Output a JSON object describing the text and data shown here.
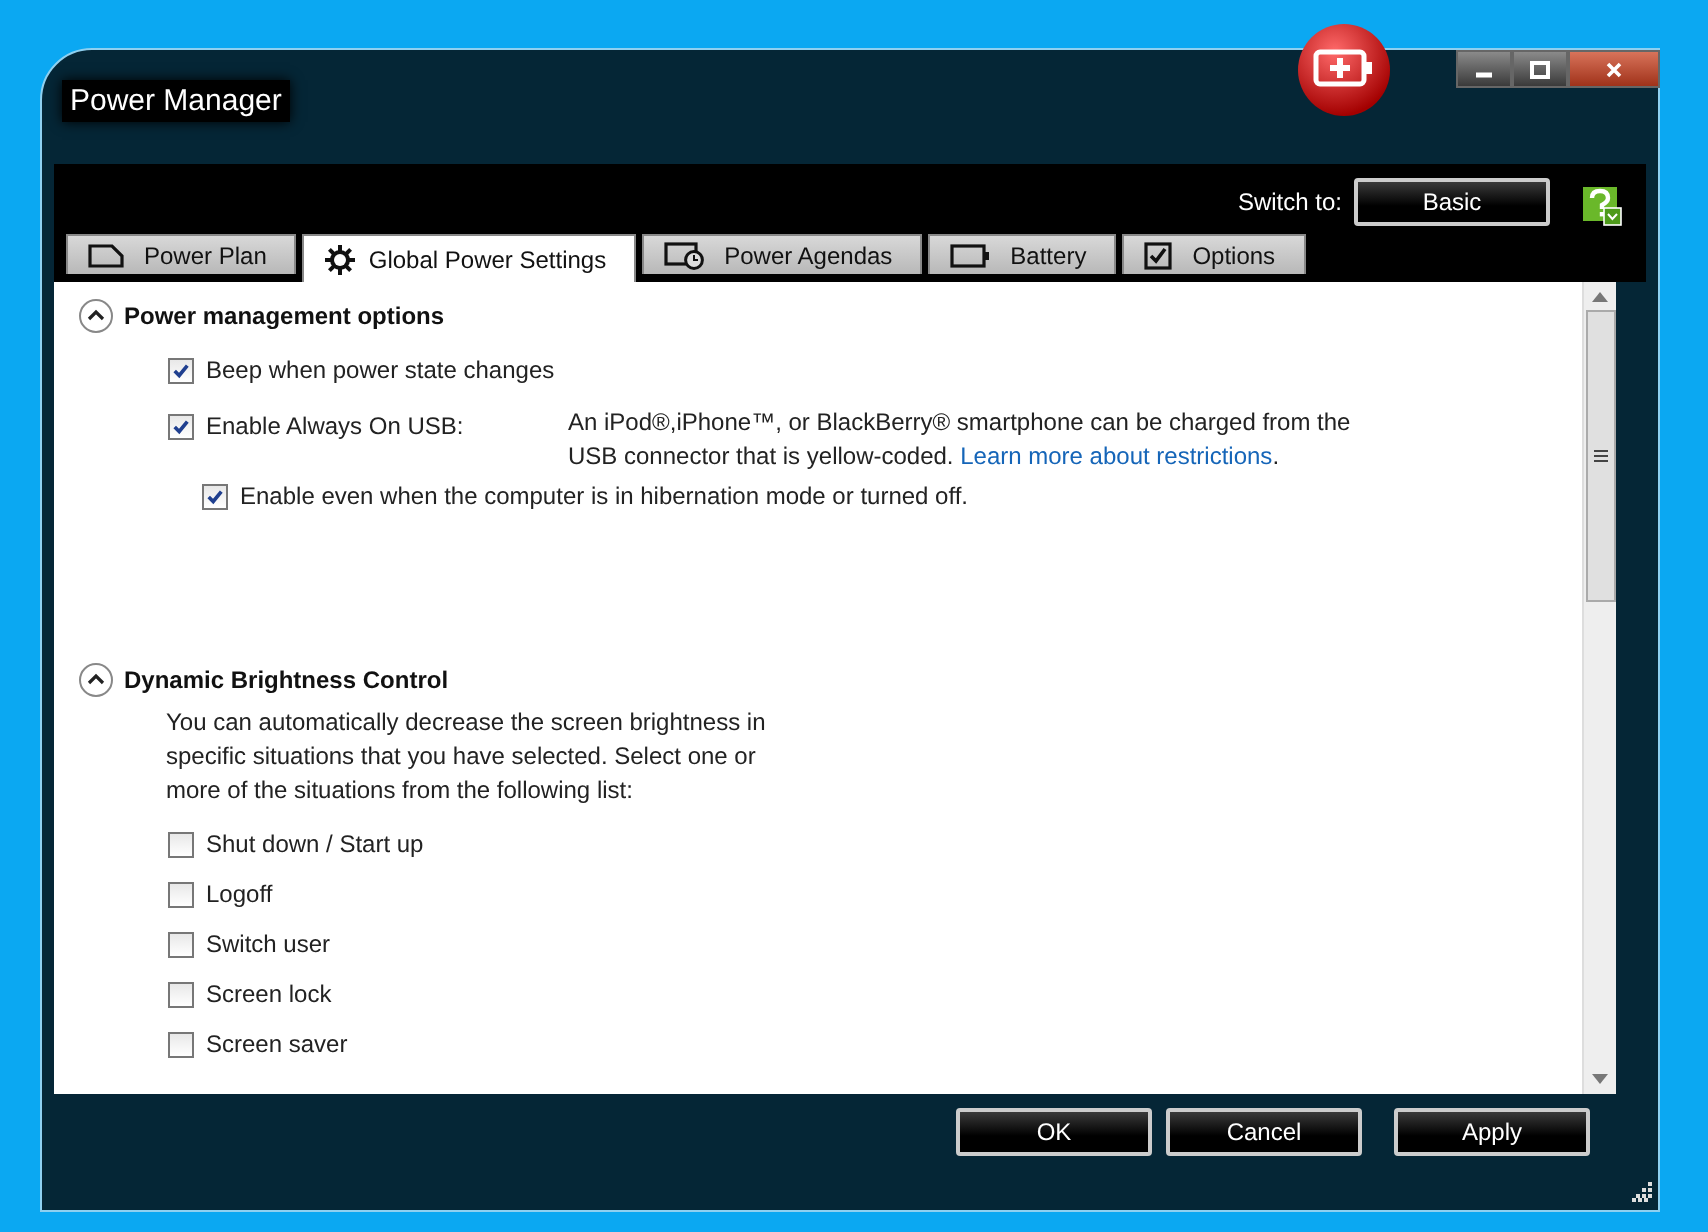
{
  "window": {
    "title": "Power Manager"
  },
  "switch_to": {
    "label": "Switch to:",
    "button": "Basic"
  },
  "tabs": [
    {
      "label": "Power Plan",
      "selected": false
    },
    {
      "label": "Global Power Settings",
      "selected": true
    },
    {
      "label": "Power Agendas",
      "selected": false
    },
    {
      "label": "Battery",
      "selected": false
    },
    {
      "label": "Options",
      "selected": false
    }
  ],
  "sections": [
    {
      "title": "Power management options",
      "expanded": true,
      "options": [
        {
          "label": "Beep when power state changes",
          "checked": true
        },
        {
          "label": "Enable Always On USB:",
          "checked": true,
          "description": "An iPod®,iPhone™, or BlackBerry® smartphone can be charged from the USB connector that is yellow-coded.",
          "link": "Learn more about restrictions",
          "after_link": ".",
          "suboption": {
            "label": "Enable even when the computer is in hibernation mode or turned off.",
            "checked": true
          }
        }
      ]
    },
    {
      "title": "Dynamic Brightness Control",
      "expanded": true,
      "intro": "You can automatically decrease the screen brightness in specific situations that you have selected. Select one or more of the situations from the following list:",
      "options": [
        {
          "label": "Shut down / Start up",
          "checked": false
        },
        {
          "label": "Logoff",
          "checked": false
        },
        {
          "label": "Switch user",
          "checked": false
        },
        {
          "label": "Screen lock",
          "checked": false
        },
        {
          "label": "Screen saver",
          "checked": false
        }
      ]
    }
  ],
  "buttons": [
    "OK",
    "Cancel",
    "Apply"
  ]
}
